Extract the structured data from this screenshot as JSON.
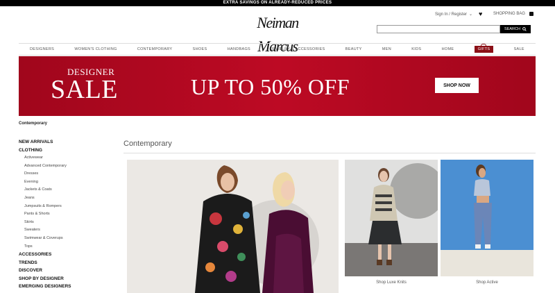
{
  "promo_bar": "EXTRA SAVINGS ON ALREADY-REDUCED PRICES",
  "logo": "Neiman Marcus",
  "header": {
    "account": "Sign In / Register",
    "bag": "SHOPPING BAG",
    "search": {
      "placeholder": "",
      "button": "SEARCH"
    }
  },
  "nav": [
    "DESIGNERS",
    "WOMEN'S CLOTHING",
    "CONTEMPORARY",
    "SHOES",
    "HANDBAGS",
    "JEWELRY & ACCESSORIES",
    "BEAUTY",
    "MEN",
    "KIDS",
    "HOME",
    "GIFTS",
    "SALE"
  ],
  "banner": {
    "sub": "DESIGNER",
    "title": "SALE",
    "headline": "UP TO 50% OFF",
    "cta": "SHOP NOW"
  },
  "breadcrumb": "Contemporary",
  "sidebar": {
    "top": [
      "NEW ARRIVALS",
      "CLOTHING"
    ],
    "clothing": [
      "Activewear",
      "Advanced Contemporary",
      "Dresses",
      "Evening",
      "Jackets & Coats",
      "Jeans",
      "Jumpsuits & Rompers",
      "Pants & Shorts",
      "Skirts",
      "Sweaters",
      "Swimwear & Coverups",
      "Tops"
    ],
    "bottom": [
      "ACCESSORIES",
      "TRENDS",
      "DISCOVER",
      "SHOP BY DESIGNER",
      "EMERGING DESIGNERS"
    ]
  },
  "page_title": "Contemporary",
  "tiles": [
    {
      "caption": "Shop Luxe Knits"
    },
    {
      "caption": "Shop Active"
    }
  ],
  "colors": {
    "banner": "#b0081f",
    "gift": "#8b0f16",
    "black": "#000000"
  }
}
